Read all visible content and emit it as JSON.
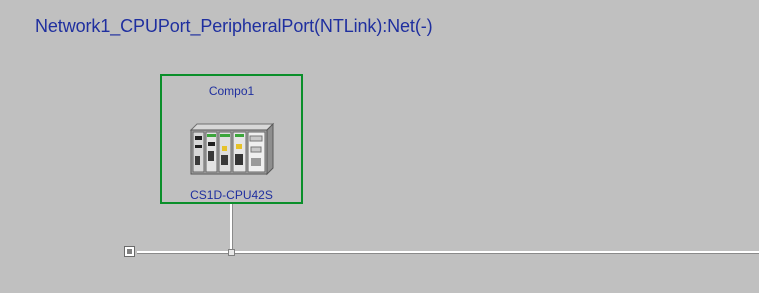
{
  "network": {
    "title": "Network1_CPUPort_PeripheralPort(NTLink):Net(-)"
  },
  "component": {
    "name": "Compo1",
    "model": "CS1D-CPU42S",
    "icon": "plc-rack-icon",
    "border_color": "#0a8f2a",
    "text_color": "#1f2f9f"
  },
  "colors": {
    "canvas_background": "#c0c0c0",
    "title_text": "#1f2f9f",
    "bus_line": "#ffffff"
  }
}
